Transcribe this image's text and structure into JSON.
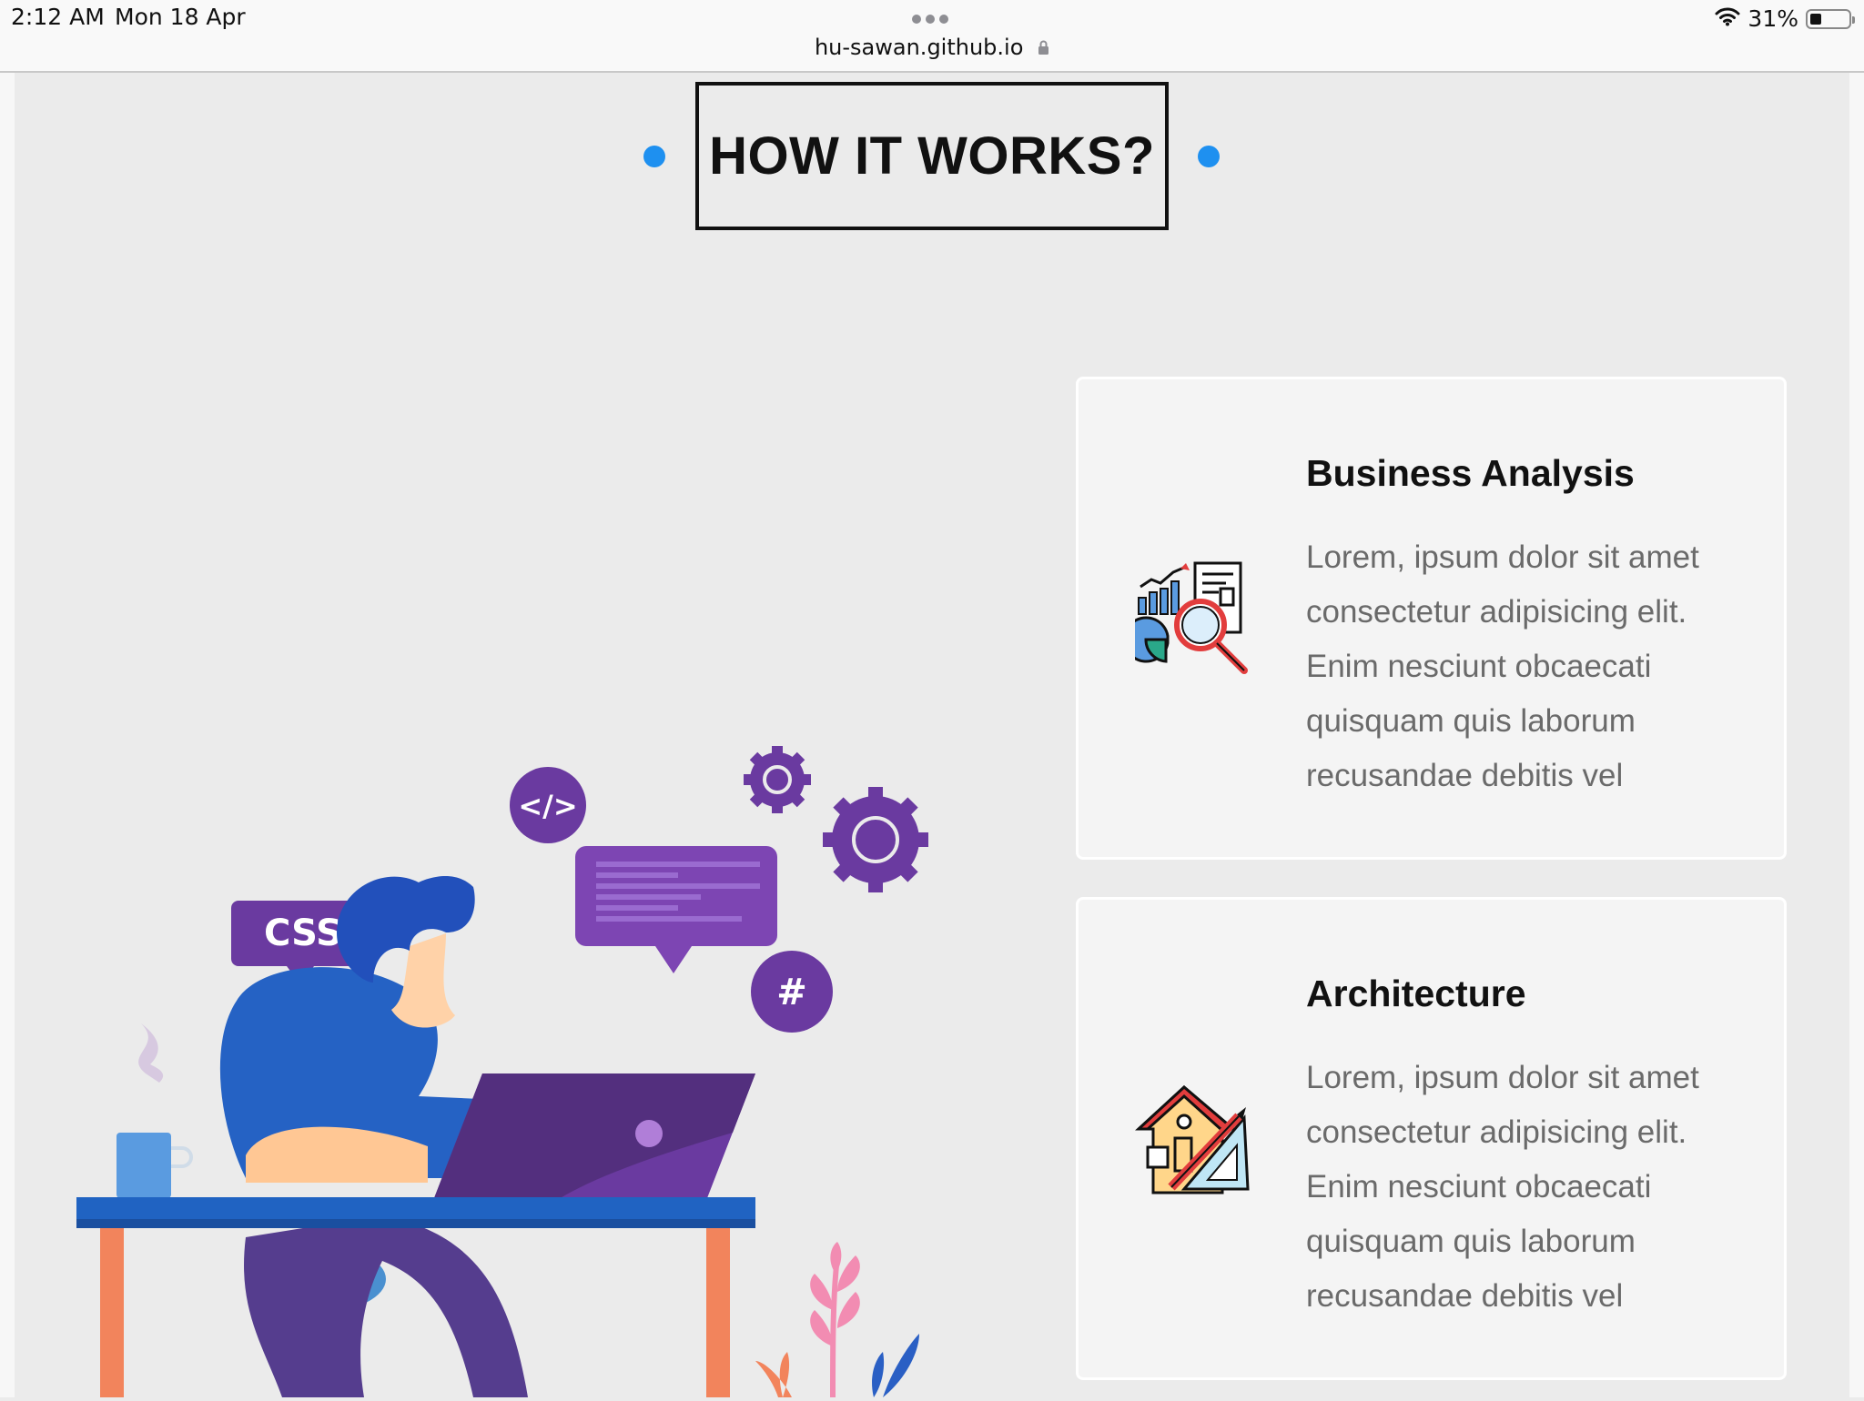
{
  "status_bar": {
    "time": "2:12 AM",
    "date": "Mon 18 Apr",
    "url": "hu-sawan.github.io",
    "battery": "31%",
    "icons": [
      "wifi-icon",
      "battery-icon",
      "lock-icon",
      "more-dots-icon"
    ]
  },
  "section": {
    "title": "HOW IT WORKS?"
  },
  "colors": {
    "accent_dot": "#1e90f0",
    "illustration_purple": "#6a3aa0",
    "illustration_blue": "#2a5fc4"
  },
  "illustration": {
    "css_label": "CSS",
    "code_label": "</>",
    "hash_label": "#"
  },
  "cards": [
    {
      "title": "Business Analysis",
      "text": "Lorem, ipsum dolor sit amet consectetur adipisicing elit. Enim nesciunt obcaecati quisquam quis laborum recusandae debitis vel",
      "icon": "business-analysis-icon"
    },
    {
      "title": "Architecture",
      "text": "Lorem, ipsum dolor sit amet consectetur adipisicing elit. Enim nesciunt obcaecati quisquam quis laborum recusandae debitis vel",
      "icon": "architecture-icon"
    }
  ]
}
